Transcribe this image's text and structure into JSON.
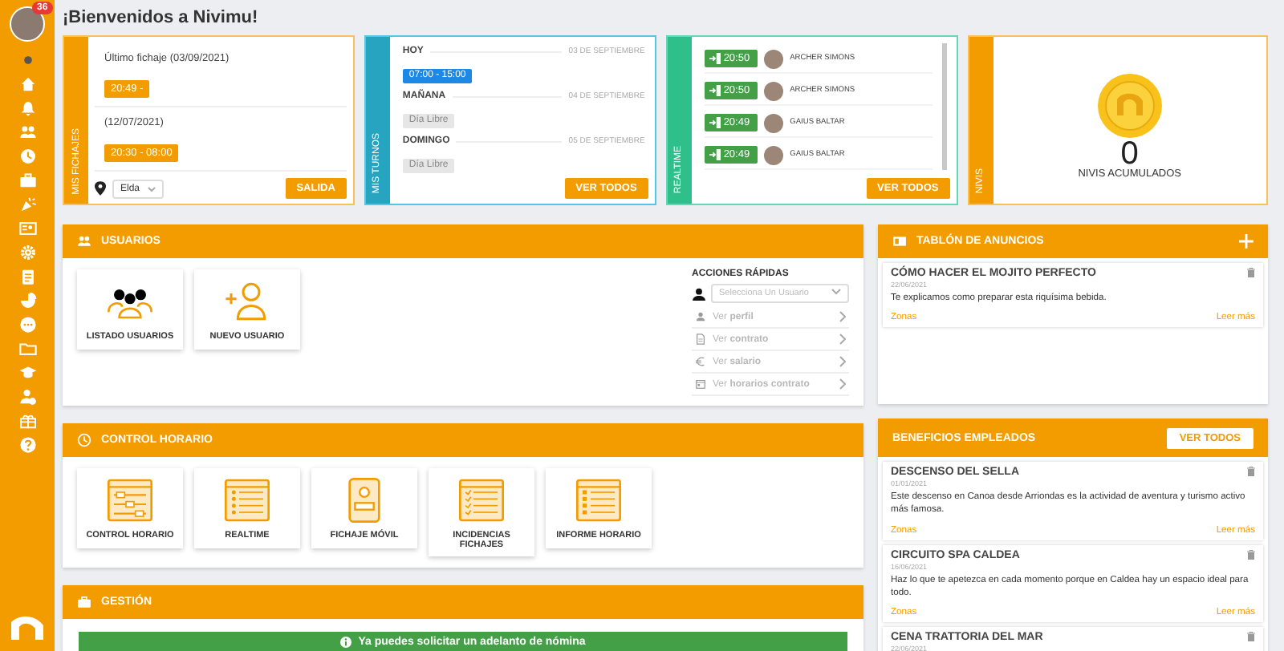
{
  "user": {
    "badge": "36"
  },
  "title": "¡Bienvenidos a Nivimu!",
  "fichajes": {
    "label": "MIS FICHAJES",
    "entries": [
      {
        "date": "Último fichaje (03/09/2021)",
        "time": "20:49 -"
      },
      {
        "date": "(12/07/2021)",
        "time": "20:30 - 08:00"
      }
    ],
    "location": "Elda",
    "button": "SALIDA"
  },
  "turnos": {
    "label": "MIS TURNOS",
    "days": [
      {
        "day": "HOY",
        "date": "03 DE SEPTIEMBRE",
        "shift": "07:00 - 15:00",
        "kind": "shift"
      },
      {
        "day": "MAÑANA",
        "date": "04 DE SEPTIEMBRE",
        "shift": "Día Libre",
        "kind": "off"
      },
      {
        "day": "DOMINGO",
        "date": "05 DE SEPTIEMBRE",
        "shift": "Día Libre",
        "kind": "off"
      }
    ],
    "button": "VER TODOS"
  },
  "realtime": {
    "label": "REALTIME",
    "entries": [
      {
        "time": "20:50",
        "name": "ARCHER SIMONS"
      },
      {
        "time": "20:50",
        "name": "ARCHER SIMONS"
      },
      {
        "time": "20:49",
        "name": "GAIUS BALTAR"
      },
      {
        "time": "20:49",
        "name": "GAIUS BALTAR"
      }
    ],
    "button": "VER TODOS"
  },
  "nivis": {
    "label": "NIVIS",
    "count": "0",
    "caption": "NIVIS ACUMULADOS"
  },
  "usuarios": {
    "title": "USUARIOS",
    "tiles": [
      {
        "label": "LISTADO USUARIOS",
        "kind": "group"
      },
      {
        "label": "NUEVO USUARIO",
        "kind": "add-user"
      }
    ],
    "quick_actions": {
      "title": "ACCIONES RÁPIDAS",
      "placeholder": "Selecciona Un Usuario",
      "items": [
        {
          "label": "Ver **perfil**",
          "kind": "person",
          "disabled": true
        },
        {
          "label": "Ver **contrato**",
          "kind": "document",
          "disabled": true
        },
        {
          "label": "Ver **salario**",
          "kind": "euro",
          "disabled": true
        },
        {
          "label": "Ver **horarios contrato**",
          "kind": "calendar",
          "disabled": true
        }
      ]
    }
  },
  "control_horario": {
    "title": "CONTROL HORARIO",
    "tiles": [
      {
        "label": "CONTROL HORARIO",
        "kind": "sliders"
      },
      {
        "label": "REALTIME",
        "kind": "list"
      },
      {
        "label": "FICHAJE MÓVIL",
        "kind": "phone"
      },
      {
        "label": "INCIDENCIAS FICHAJES",
        "kind": "checklist"
      },
      {
        "label": "INFORME HORARIO",
        "kind": "report"
      }
    ]
  },
  "gestion": {
    "title": "GESTIÓN",
    "notice": "Ya puedes solicitar un adelanto de nómina"
  },
  "tablon": {
    "title": "TABLÓN DE ANUNCIOS",
    "posts": [
      {
        "title": "CÓMO HACER EL MOJITO PERFECTO",
        "date": "22/06/2021",
        "text": "Te explicamos como preparar esta riquísima bebida.",
        "tag": "Zonas",
        "link": "Leer más"
      }
    ]
  },
  "beneficios": {
    "title": "BENEFICIOS EMPLEADOS",
    "button": "VER TODOS",
    "posts": [
      {
        "title": "DESCENSO DEL SELLA",
        "date": "01/01/2021",
        "text": "Este descenso en Canoa desde Arriondas es la actividad de aventura y turismo activo más famosa.",
        "tag": "Zonas",
        "link": "Leer más"
      },
      {
        "title": "CIRCUITO SPA CALDEA",
        "date": "16/06/2021",
        "text": "Haz lo que te apetezca en cada momento porque en Caldea hay un espacio ideal para todo.",
        "tag": "Zonas",
        "link": "Leer más"
      },
      {
        "title": "CENA TRATTORIA DEL MAR",
        "date": "22/06/2021"
      }
    ]
  }
}
